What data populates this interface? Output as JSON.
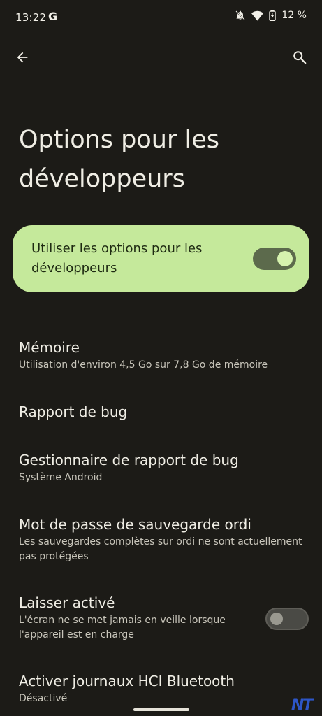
{
  "status_bar": {
    "time": "13:22",
    "g_logo": "G",
    "battery_text": "12 %",
    "icons": [
      "bell-off-icon",
      "wifi-icon",
      "battery-icon"
    ]
  },
  "top_bar": {
    "back_icon": "arrow-back-icon",
    "search_icon": "search-icon"
  },
  "page": {
    "title": "Options pour les développeurs"
  },
  "main_switch": {
    "label": "Utiliser les options pour les développeurs",
    "enabled": true
  },
  "items": [
    {
      "title": "Mémoire",
      "summary": "Utilisation d'environ 4,5 Go sur 7,8 Go de mémoire"
    },
    {
      "title": "Rapport de bug",
      "summary": ""
    },
    {
      "title": "Gestionnaire de rapport de bug",
      "summary": "Système Android"
    },
    {
      "title": "Mot de passe de sauvegarde ordi",
      "summary": "Les sauvegardes complètes sur ordi ne sont actuellement pas protégées"
    },
    {
      "title": "Laisser activé",
      "summary": "L'écran ne se met jamais en veille lorsque l'appareil est en charge",
      "toggle": false
    },
    {
      "title": "Activer journaux HCI Bluetooth",
      "summary": "Désactivé"
    }
  ],
  "watermark": {
    "text": "NT"
  },
  "colors": {
    "background": "#1c1b17",
    "card": "#c5e99b",
    "toggle_on_track": "#5c6a4c",
    "toggle_on_knob": "#d6f2ae",
    "text_primary": "#efede4",
    "text_secondary": "#c9c6bb"
  }
}
